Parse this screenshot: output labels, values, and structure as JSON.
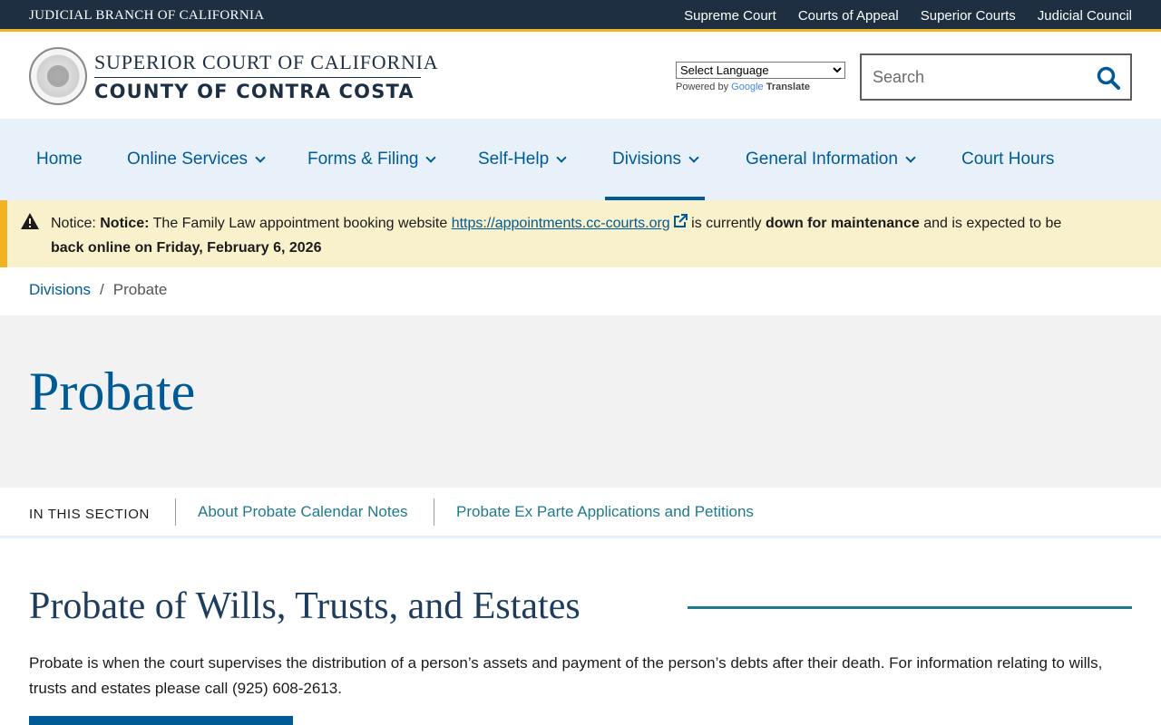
{
  "topbar": {
    "branch": "JUDICIAL BRANCH OF CALIFORNIA",
    "links": [
      "Supreme Court",
      "Courts of Appeal",
      "Superior Courts",
      "Judicial Council"
    ]
  },
  "header": {
    "line1": "SUPERIOR COURT OF CALIFORNIA",
    "line2": "COUNTY OF CONTRA COSTA",
    "translate": {
      "select_label": "Select Language",
      "powered_by": "Powered by",
      "google": "Google",
      "translate": "Translate"
    },
    "search": {
      "placeholder": "Search"
    }
  },
  "nav": {
    "items": [
      {
        "label": "Home",
        "has_menu": false
      },
      {
        "label": "Online Services",
        "has_menu": true
      },
      {
        "label": "Forms & Filing",
        "has_menu": true
      },
      {
        "label": "Self-Help",
        "has_menu": true
      },
      {
        "label": "Divisions",
        "has_menu": true,
        "active": true
      },
      {
        "label": "General Information",
        "has_menu": true
      },
      {
        "label": "Court Hours",
        "has_menu": false
      }
    ]
  },
  "notice": {
    "prefix": "Notice: ",
    "strong_label": "Notice:",
    "text1": " The Family Law appointment booking website ",
    "link": "https://appointments.cc-courts.org",
    "text2": " is currently ",
    "strong1": "down for maintenance",
    "text3": " and is expected to be ",
    "strong2": "back online on Friday, February 6, 2026"
  },
  "breadcrumb": {
    "parent": "Divisions",
    "separator": "/",
    "current": "Probate"
  },
  "hero": {
    "title": "Probate"
  },
  "section_nav": {
    "label": "IN THIS SECTION",
    "links": [
      "About Probate Calendar Notes",
      "Probate Ex Parte Applications and Petitions"
    ]
  },
  "content": {
    "title": "Probate of Wills, Trusts, and Estates",
    "body": "Probate is when the court supervises the distribution of a person’s assets and payment of the person’s debts after their death. For information relating to wills, trusts and estates please call (925) 608-2613."
  },
  "colors": {
    "topbar": "#1e2f42",
    "accent_gold": "#f2b320",
    "link_blue": "#005a95",
    "nav_bg": "#e8f1f9",
    "notice_bg": "#f9f1cc",
    "teal": "#1f7a8c"
  }
}
